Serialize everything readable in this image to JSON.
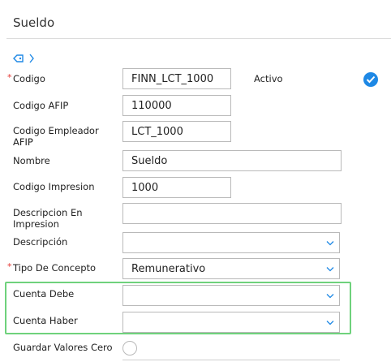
{
  "page": {
    "title": "Sueldo"
  },
  "form": {
    "codigo": {
      "label": "Codigo",
      "value": "FINN_LCT_1000",
      "required": true
    },
    "activo": {
      "label": "Activo",
      "checked": true
    },
    "codigo_afip": {
      "label": "Codigo AFIP",
      "value": "110000"
    },
    "codigo_empleador_afip": {
      "label": "Codigo Empleador AFIP",
      "value": "LCT_1000"
    },
    "nombre": {
      "label": "Nombre",
      "value": "Sueldo"
    },
    "codigo_impresion": {
      "label": "Codigo Impresion",
      "value": "1000"
    },
    "descripcion_en_impresion": {
      "label": "Descripcion En Impresion",
      "value": ""
    },
    "descripcion": {
      "label": "Descripción",
      "value": ""
    },
    "tipo_de_concepto": {
      "label": "Tipo De Concepto",
      "value": "Remunerativo",
      "required": true
    },
    "cuenta_debe": {
      "label": "Cuenta Debe",
      "value": ""
    },
    "cuenta_haber": {
      "label": "Cuenta Haber",
      "value": ""
    },
    "guardar_valores_cero": {
      "label": "Guardar Valores Cero",
      "checked": false
    }
  },
  "colors": {
    "accent": "#1e88e5",
    "highlight": "#6fd27c",
    "required": "#e53935"
  },
  "icons": {
    "breadcrumb": [
      "tag-icon",
      "chevron-right-icon"
    ],
    "dropdown": "chevron-down-icon",
    "active": "check-circle-icon"
  }
}
